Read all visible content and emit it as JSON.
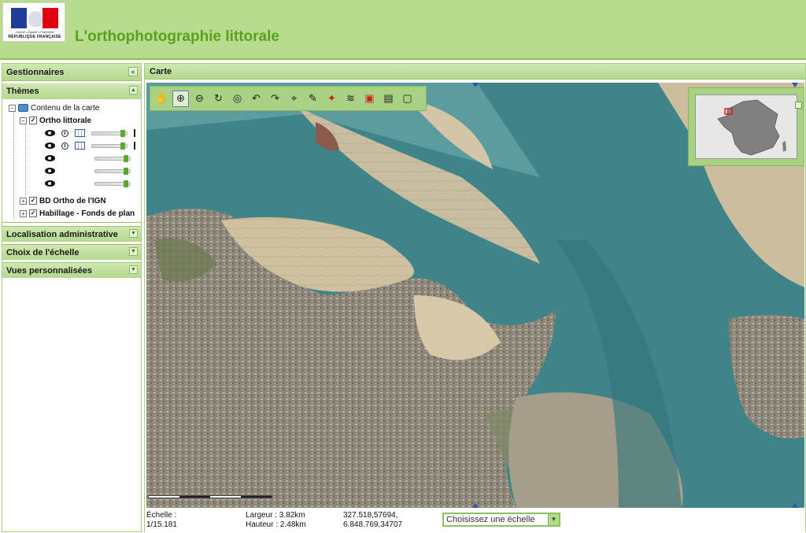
{
  "header": {
    "title": "L'orthophotographie littorale",
    "logo": {
      "motto": "Liberté • Égalité • Fraternité",
      "republic": "RÉPUBLIQUE FRANÇAISE"
    }
  },
  "left_panel": {
    "title": "Gestionnaires",
    "collapse_icon": "double-chevron-left",
    "themes": {
      "title": "Thèmes",
      "tree": {
        "root": "Contenu de la carte",
        "ortho": "Ortho littorale",
        "bd_ortho": "BD Ortho de l'IGN",
        "habillage": "Habillage - Fonds de plan"
      }
    },
    "sections": [
      {
        "label": "Localisation administrative"
      },
      {
        "label": "Choix de l'échelle"
      },
      {
        "label": "Vues personnalisées"
      }
    ]
  },
  "map_panel": {
    "title": "Carte",
    "tools": [
      "pan-hand-icon",
      "zoom-in-icon",
      "zoom-out-icon",
      "refresh-icon",
      "zoom-extent-icon",
      "previous-view-icon",
      "next-view-icon",
      "coordinates-icon",
      "measure-icon",
      "info-icon",
      "layers-icon",
      "pdf-icon",
      "save-icon",
      "fullscreen-icon"
    ]
  },
  "status": {
    "scale_label": "Échelle :",
    "scale_value": "1/15.181",
    "width_label": "Largeur : 3.82km",
    "height_label": "Hauteur : 2.48km",
    "coord_1": "327.518,57694,",
    "coord_2": "6.848.769,34707",
    "scale_select_placeholder": "Choisissez une échelle"
  },
  "colors": {
    "accent_green": "#5a9f1e",
    "panel_green": "#b5d88f",
    "sea": "#3a7f86",
    "sand": "#d9c9a8"
  }
}
